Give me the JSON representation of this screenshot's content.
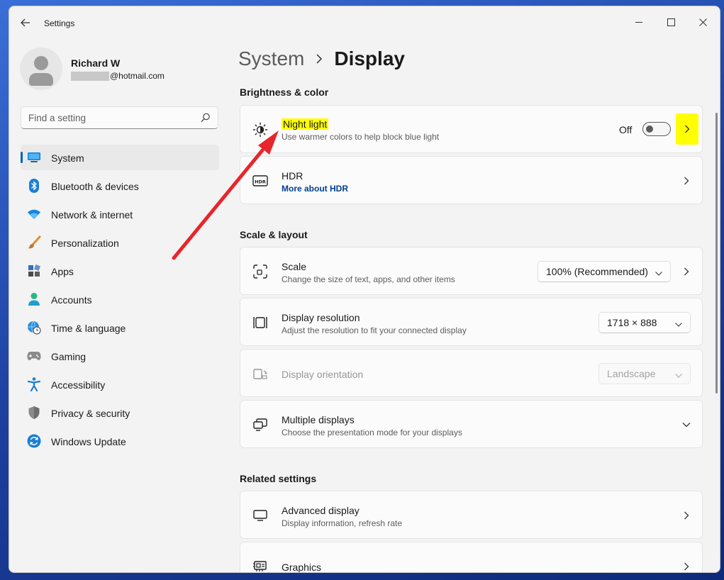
{
  "window": {
    "title": "Settings",
    "controls": {
      "minimize": "minimize-icon",
      "maximize": "maximize-icon",
      "close": "close-icon"
    }
  },
  "user": {
    "name": "Richard W",
    "email_visible": "@hotmail.com"
  },
  "search": {
    "placeholder": "Find a setting"
  },
  "sidebar": {
    "items": [
      {
        "label": "System",
        "icon": "display-icon",
        "active": true
      },
      {
        "label": "Bluetooth & devices",
        "icon": "bluetooth-icon"
      },
      {
        "label": "Network & internet",
        "icon": "wifi-icon"
      },
      {
        "label": "Personalization",
        "icon": "brush-icon"
      },
      {
        "label": "Apps",
        "icon": "apps-icon"
      },
      {
        "label": "Accounts",
        "icon": "person-icon"
      },
      {
        "label": "Time & language",
        "icon": "globe-clock-icon"
      },
      {
        "label": "Gaming",
        "icon": "gamepad-icon"
      },
      {
        "label": "Accessibility",
        "icon": "accessibility-icon"
      },
      {
        "label": "Privacy & security",
        "icon": "shield-icon"
      },
      {
        "label": "Windows Update",
        "icon": "update-icon"
      }
    ]
  },
  "breadcrumb": {
    "parent": "System",
    "current": "Display"
  },
  "sections": {
    "brightness": "Brightness & color",
    "scale_layout": "Scale & layout",
    "related": "Related settings"
  },
  "cards": {
    "night_light": {
      "title": "Night light",
      "subtitle": "Use warmer colors to help block blue light",
      "toggle_label": "Off",
      "toggle_on": false,
      "icon": "brightness-icon"
    },
    "hdr": {
      "title": "HDR",
      "link": "More about HDR",
      "icon": "hdr-icon"
    },
    "scale": {
      "title": "Scale",
      "subtitle": "Change the size of text, apps, and other items",
      "value": "100% (Recommended)",
      "icon": "scale-icon"
    },
    "resolution": {
      "title": "Display resolution",
      "subtitle": "Adjust the resolution to fit your connected display",
      "value": "1718 × 888",
      "icon": "resolution-icon"
    },
    "orientation": {
      "title": "Display orientation",
      "value": "Landscape",
      "icon": "orientation-icon",
      "disabled": true
    },
    "multiple": {
      "title": "Multiple displays",
      "subtitle": "Choose the presentation mode for your displays",
      "icon": "multiple-displays-icon"
    },
    "advanced": {
      "title": "Advanced display",
      "subtitle": "Display information, refresh rate",
      "icon": "monitor-icon"
    },
    "graphics": {
      "title": "Graphics",
      "icon": "graphics-icon"
    }
  },
  "colors": {
    "accent": "#005fb8",
    "highlight": "#ffff00",
    "annotation_arrow": "#e8252a"
  }
}
